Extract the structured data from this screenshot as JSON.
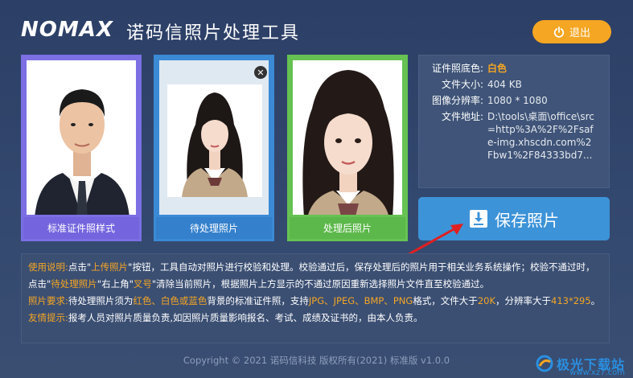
{
  "header": {
    "logo": "NOMAX",
    "title": "诺码信照片处理工具",
    "exit_label": "退出"
  },
  "cards": {
    "standard_caption": "标准证件照样式",
    "pending_caption": "待处理照片",
    "processed_caption": "处理后照片",
    "remove_glyph": "✕"
  },
  "info": {
    "bg_color_label": "证件照底色:",
    "bg_color_value": "白色",
    "file_size_label": "文件大小:",
    "file_size_value": "404 KB",
    "resolution_label": "图像分辨率:",
    "resolution_value": "1080 * 1080",
    "path_label": "文件地址:",
    "path_value": "D:\\tools\\桌面\\office\\src=http%3A%2F%2Fsafe-img.xhscdn.com%2Fbw1%2F84333bd7..."
  },
  "save_label": "保存照片",
  "instructions": {
    "usage_title": "使用说明:",
    "usage_p1": "点击\"",
    "usage_hl1": "上传照片",
    "usage_p2": "\"按钮，工具自动对照片进行校验和处理。校验通过后，保存处理后的照片用于相关业务系统操作；校验不通过时，点击\"",
    "usage_hl2": "待处理照片",
    "usage_p3": "\"右上角\"",
    "usage_hl3": "叉号",
    "usage_p4": "\"清除当前照片，根据照片上方显示的不通过原因重新选择照片文件直至校验通过。",
    "req_title": "照片要求:",
    "req_p1": "待处理照片须为",
    "req_hl1": "红色、白色或蓝色",
    "req_p2": "背景的标准证件照，支持",
    "req_hl2": "JPG、JPEG、BMP、PNG",
    "req_p3": "格式，文件大于",
    "req_hl3": "20K",
    "req_p4": "，分辨率大于",
    "req_hl4": "413*295",
    "req_p5": "。",
    "tip_title": "友情提示:",
    "tip_text": "报考人员对照片质量负责,如因照片质量影响报名、考试、成绩及证书的，由本人负责。"
  },
  "footer": "Copyright © 2021 诺码信科技 版权所有(2021) 标准版 v1.0.0",
  "watermark": {
    "main": "极光下载站",
    "sub": "www.xz7.com"
  },
  "colors": {
    "accent": "#f5a623",
    "background": "#2c3f66",
    "save_button": "#3d93d8",
    "standard_card": "#7b6fe3",
    "pending_card": "#3b8ad6",
    "processed_card": "#66c253",
    "arrow": "#e02020"
  }
}
